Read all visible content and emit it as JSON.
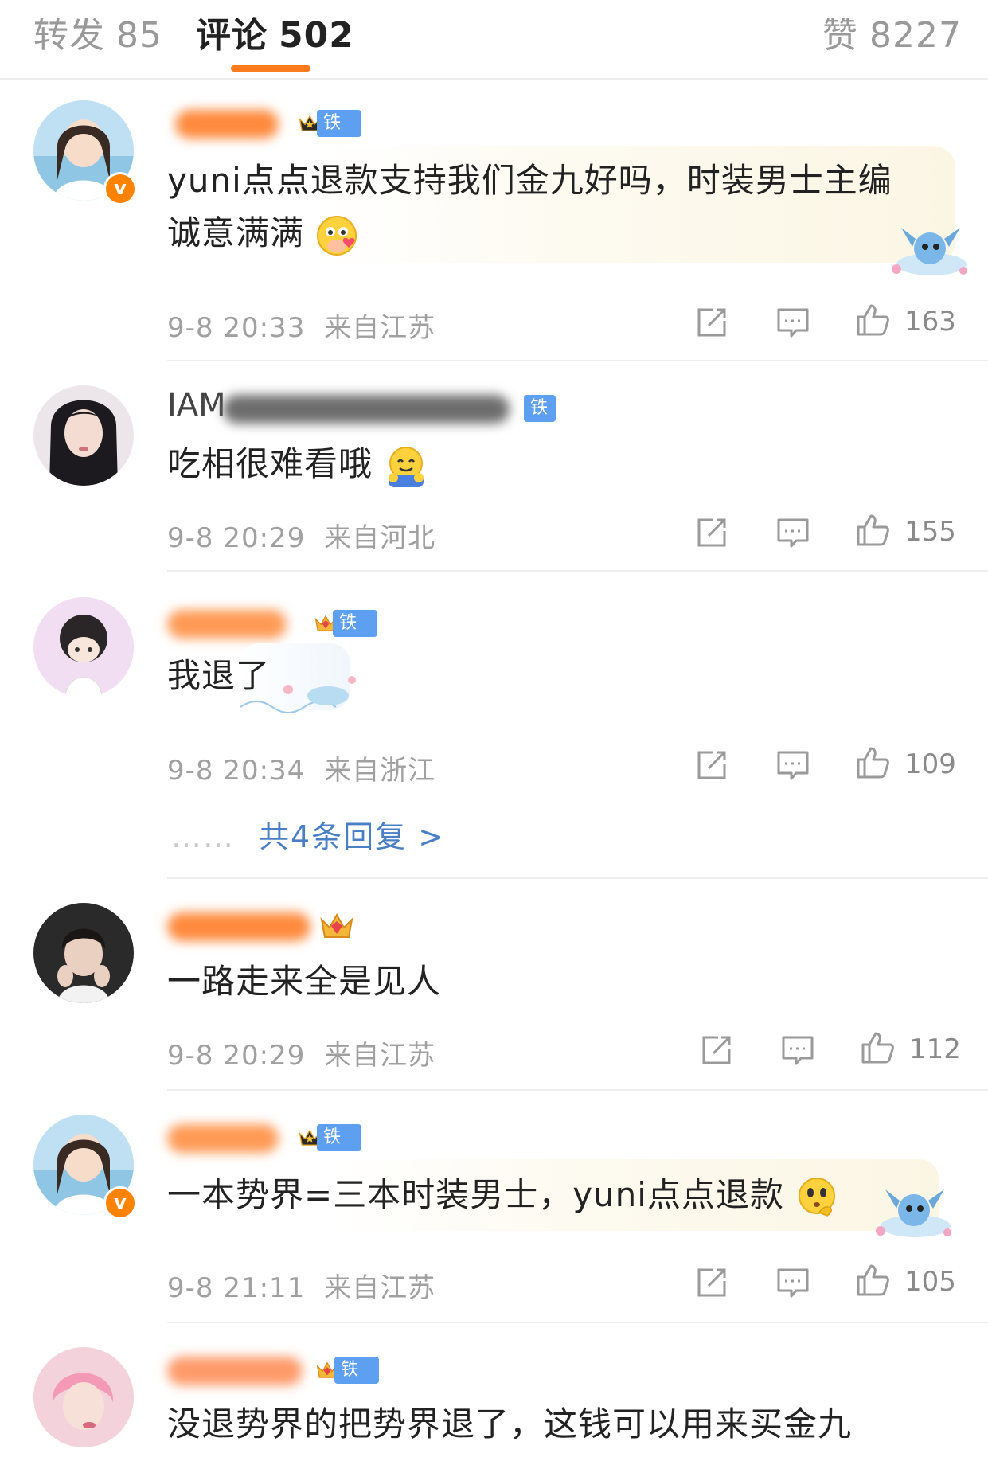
{
  "tabs": {
    "repost": {
      "label": "转发",
      "count": "85"
    },
    "comments": {
      "label": "评论",
      "count": "502"
    },
    "likes": {
      "label": "赞",
      "count": "8227"
    }
  },
  "comments": [
    {
      "text1": "yuni点点退款支持我们金九好吗，时装男士主编",
      "text2": "诚意满满",
      "fan_badge": "铁粉2",
      "time": "9-8 20:33",
      "location": "来自江苏",
      "likes": "163"
    },
    {
      "text1": "吃相很难看哦",
      "fan_badge": "铁粉1",
      "name_partial": "IAM",
      "time": "9-8 20:29",
      "location": "来自河北",
      "likes": "155"
    },
    {
      "text1": "我退了",
      "fan_badge": "铁粉2",
      "time": "9-8 20:34",
      "location": "来自浙江",
      "likes": "109",
      "replies": "共4条回复 >"
    },
    {
      "text1": "一路走来全是见人",
      "time": "9-8 20:29",
      "location": "来自江苏",
      "likes": "112"
    },
    {
      "text1": "一本势界=三本时装男士，yuni点点退款",
      "fan_badge": "铁粉2",
      "time": "9-8 21:11",
      "location": "来自江苏",
      "likes": "105"
    },
    {
      "text1": "没退势界的把势界退了，这钱可以用来买金九",
      "fan_badge": "铁粉2"
    }
  ],
  "colors": {
    "accent": "#ff7a1a",
    "fan_badge": "#5d9ff0",
    "link": "#4a7fc6",
    "verified": "#ff8200"
  },
  "icons": [
    "share-icon",
    "comment-icon",
    "like-icon",
    "crown-icon",
    "verified-icon"
  ]
}
